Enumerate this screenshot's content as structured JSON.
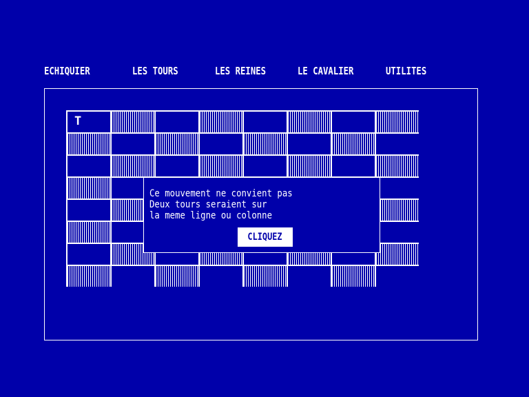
{
  "menu": {
    "items": [
      "ECHIQUIER",
      "LES TOURS",
      "LES REINES",
      "LE CAVALIER",
      "UTILITES"
    ]
  },
  "board": {
    "piece_symbol": "T",
    "piece_square": "a8"
  },
  "dialog": {
    "line1": "Ce mouvement ne convient pas",
    "line2": "Deux tours seraient sur",
    "line3": "la meme ligne ou colonne",
    "button_label": "CLIQUEZ"
  },
  "colors": {
    "background": "#0000aa",
    "foreground": "#ffffff"
  }
}
